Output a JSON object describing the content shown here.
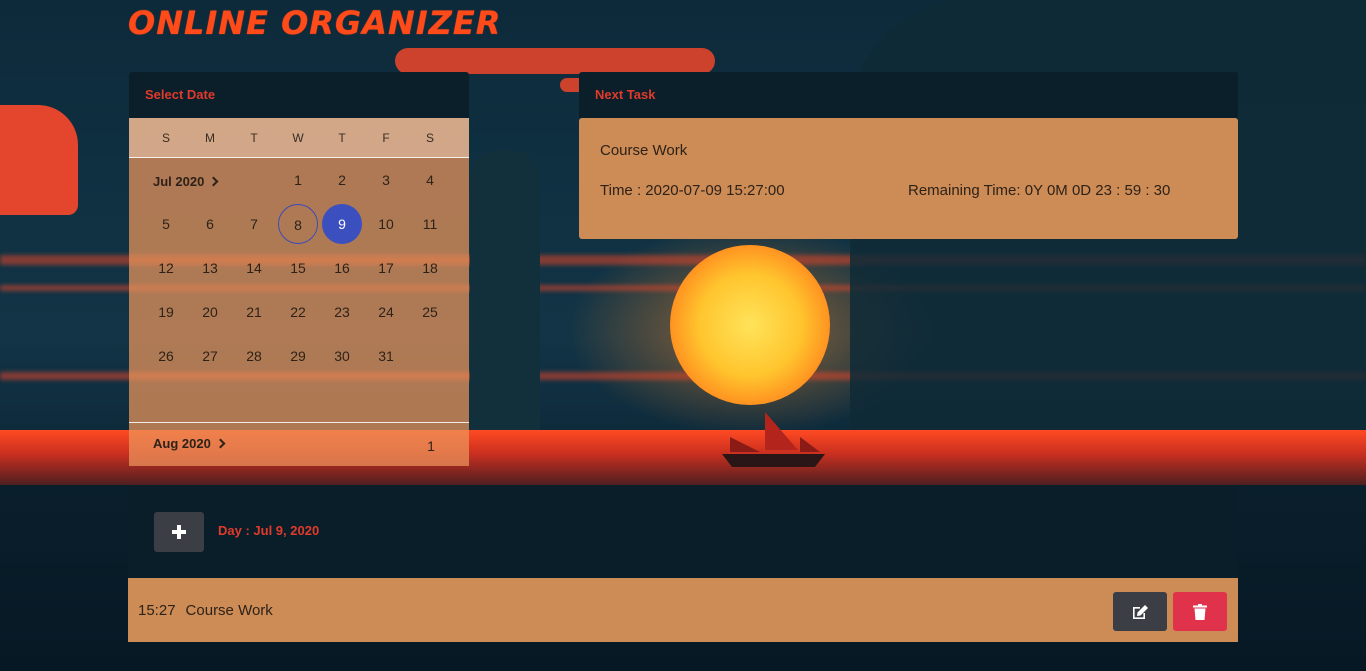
{
  "app": {
    "title": "Online Organizer"
  },
  "calendar": {
    "header": "Select Date",
    "weekdays": [
      "S",
      "M",
      "T",
      "W",
      "T",
      "F",
      "S"
    ],
    "current_month_label": "Jul 2020",
    "next_month_label": "Aug 2020",
    "next_month_first_day": "1",
    "today": 8,
    "selected": 9,
    "days": [
      "1",
      "2",
      "3",
      "4",
      "5",
      "6",
      "7",
      "8",
      "9",
      "10",
      "11",
      "12",
      "13",
      "14",
      "15",
      "16",
      "17",
      "18",
      "19",
      "20",
      "21",
      "22",
      "23",
      "24",
      "25",
      "26",
      "27",
      "28",
      "29",
      "30",
      "31"
    ]
  },
  "next_task": {
    "header": "Next Task",
    "name": "Course Work",
    "time": "Time : 2020-07-09 15:27:00",
    "remaining": "Remaining Time: 0Y 0M 0D 23 : 59 : 30"
  },
  "day_section": {
    "label": "Day : Jul 9, 2020",
    "add_icon": "plus-icon"
  },
  "tasks": [
    {
      "time": "15:27",
      "title": "Course Work",
      "edit_icon": "edit-icon",
      "delete_icon": "trash-icon"
    }
  ],
  "colors": {
    "title": "#ff4a1a",
    "header_text": "#e03a2a",
    "selected_day": "#3c4fbe",
    "card_bg": "#cd8b55",
    "delete_button": "#e0324a",
    "dark_button": "#3b3f45"
  }
}
